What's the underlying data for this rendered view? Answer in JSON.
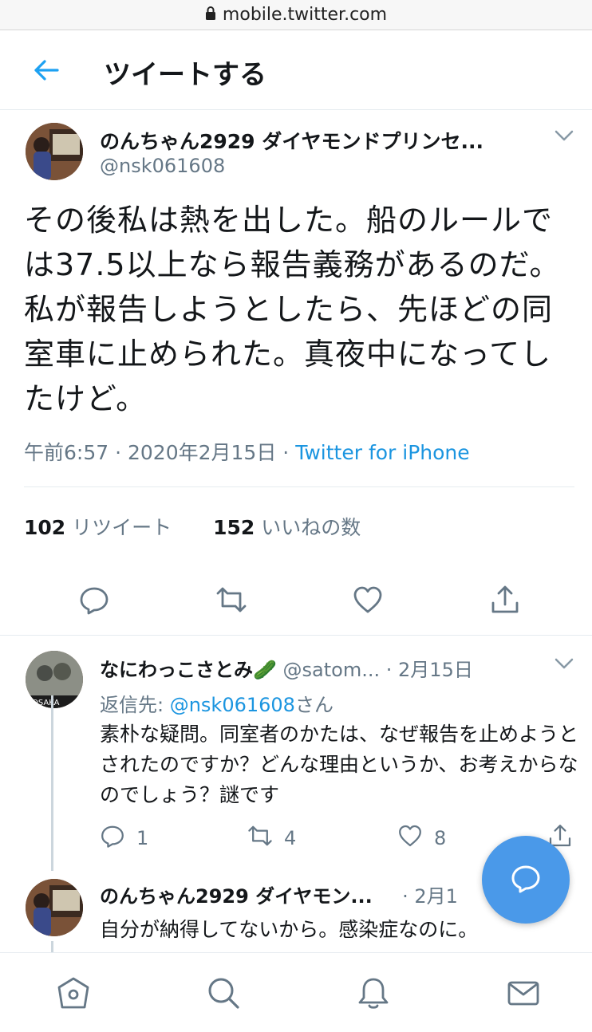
{
  "browser": {
    "url": "mobile.twitter.com"
  },
  "header": {
    "title": "ツイートする"
  },
  "main_tweet": {
    "display_name": "のんちゃん2929 ダイヤモンドプリンセ...",
    "handle": "@nsk061608",
    "text": "その後私は熱を出した。船のルールでは37.5以上なら報告義務があるのだ。私が報告しようとしたら、先ほどの同室車に止められた。真夜中になってしたけど。",
    "time": "午前6:57",
    "date": "2020年2月15日",
    "source": "Twitter for iPhone",
    "retweet_count": "102",
    "retweet_label": "リツイート",
    "like_count": "152",
    "like_label": "いいねの数"
  },
  "reply1": {
    "display_name": "なにわっこさとみ🥒",
    "handle": "@satom...",
    "date": "2月15日",
    "reply_to_prefix": "返信先: ",
    "reply_to_mention": "@nsk061608",
    "reply_to_suffix": "さん",
    "text": "素朴な疑問。同室者のかたは、なぜ報告を止めようとされたのですか？どんな理由というか、お考えからなのでしょう？謎です",
    "reply_count": "1",
    "retweet_count": "4",
    "like_count": "8"
  },
  "reply2": {
    "display_name": "のんちゃん2929 ダイヤモン...",
    "date": "2月1",
    "text": "自分が納得してないから。感染症なのに。"
  },
  "separators": {
    "dot": "·"
  },
  "colors": {
    "accent": "#1b95e0",
    "fab": "#4a99e9",
    "muted": "#657786"
  },
  "icons": {
    "back": "arrow-left-icon",
    "lock": "lock-icon",
    "caret": "chevron-down-icon",
    "reply": "reply-icon",
    "retweet": "retweet-icon",
    "like": "heart-icon",
    "share": "share-icon",
    "compose": "compose-icon",
    "nav": [
      "home-icon",
      "search-icon",
      "notifications-icon",
      "messages-icon"
    ]
  }
}
